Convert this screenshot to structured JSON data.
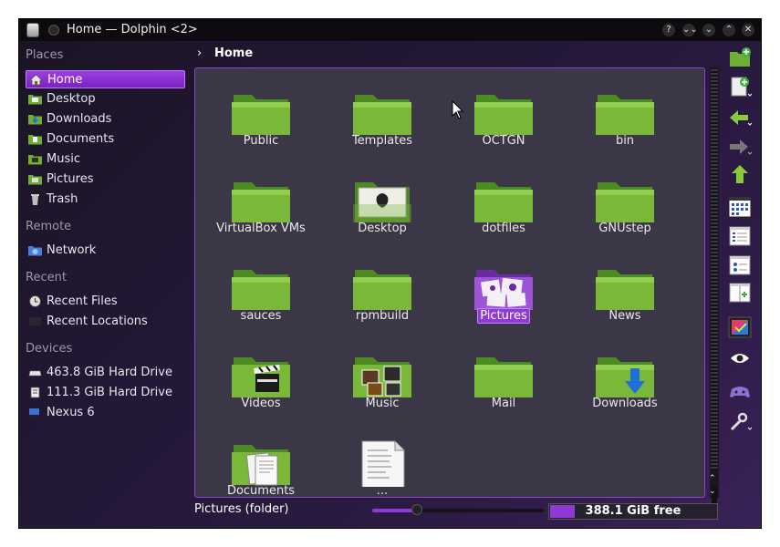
{
  "titlebar": {
    "title": "Home — Dolphin <2>",
    "buttons": [
      "?",
      "⌄⌄",
      "⌄",
      "⌃",
      "✕"
    ]
  },
  "sidebar": {
    "sections": [
      {
        "label": "Places",
        "items": [
          {
            "label": "Home",
            "icon": "home-icon",
            "selected": true
          },
          {
            "label": "Desktop",
            "icon": "desktop-folder-icon"
          },
          {
            "label": "Downloads",
            "icon": "downloads-folder-icon"
          },
          {
            "label": "Documents",
            "icon": "documents-folder-icon"
          },
          {
            "label": "Music",
            "icon": "music-folder-icon"
          },
          {
            "label": "Pictures",
            "icon": "pictures-folder-icon"
          },
          {
            "label": "Trash",
            "icon": "trash-icon"
          }
        ]
      },
      {
        "label": "Remote",
        "items": [
          {
            "label": "Network",
            "icon": "network-icon"
          }
        ]
      },
      {
        "label": "Recent",
        "items": [
          {
            "label": "Recent Files",
            "icon": "clock-icon"
          },
          {
            "label": "Recent Locations",
            "icon": "recent-locations-icon"
          }
        ]
      },
      {
        "label": "Devices",
        "items": [
          {
            "label": "463.8 GiB Hard Drive",
            "icon": "hard-drive-icon"
          },
          {
            "label": "111.3 GiB Hard Drive",
            "icon": "hard-drive-icon"
          },
          {
            "label": "Nexus 6",
            "icon": "phone-icon"
          }
        ]
      }
    ]
  },
  "breadcrumb": {
    "arrow": "›",
    "label": "Home"
  },
  "folders": [
    {
      "name": "Public",
      "icon": "folder"
    },
    {
      "name": "Templates",
      "icon": "folder"
    },
    {
      "name": "OCTGN",
      "icon": "folder"
    },
    {
      "name": "bin",
      "icon": "folder"
    },
    {
      "name": "VirtualBox VMs",
      "icon": "folder"
    },
    {
      "name": "Desktop",
      "icon": "desktop-folder"
    },
    {
      "name": "dotfiles",
      "icon": "folder"
    },
    {
      "name": "GNUstep",
      "icon": "folder"
    },
    {
      "name": "sauces",
      "icon": "folder"
    },
    {
      "name": "rpmbuild",
      "icon": "folder"
    },
    {
      "name": "Pictures",
      "icon": "pictures-folder",
      "selected": true
    },
    {
      "name": "News",
      "icon": "folder"
    },
    {
      "name": "Videos",
      "icon": "videos-folder"
    },
    {
      "name": "Music",
      "icon": "music-folder"
    },
    {
      "name": "Mail",
      "icon": "folder"
    },
    {
      "name": "Downloads",
      "icon": "downloads-folder"
    },
    {
      "name": "Documents",
      "icon": "documents-folder"
    },
    {
      "name": "...",
      "icon": "text-file"
    }
  ],
  "toolbar": {
    "icons": [
      "new-folder-icon",
      "new-file-icon",
      "back-icon",
      "forward-icon",
      "up-icon",
      "icons-view-icon",
      "compact-view-icon",
      "details-view-icon",
      "split-view-icon",
      "preview-icon",
      "show-hidden-icon",
      "controller-icon",
      "settings-wrench-icon"
    ]
  },
  "statusbar": {
    "text": "Pictures (folder)",
    "zoom_level": 0.26,
    "free_space_text": "388.1 GiB free",
    "used_fraction": 0.16
  },
  "colors": {
    "accent": "#8e3bd6",
    "folder_green": "#7ab83a",
    "background": "#2d1b45"
  }
}
